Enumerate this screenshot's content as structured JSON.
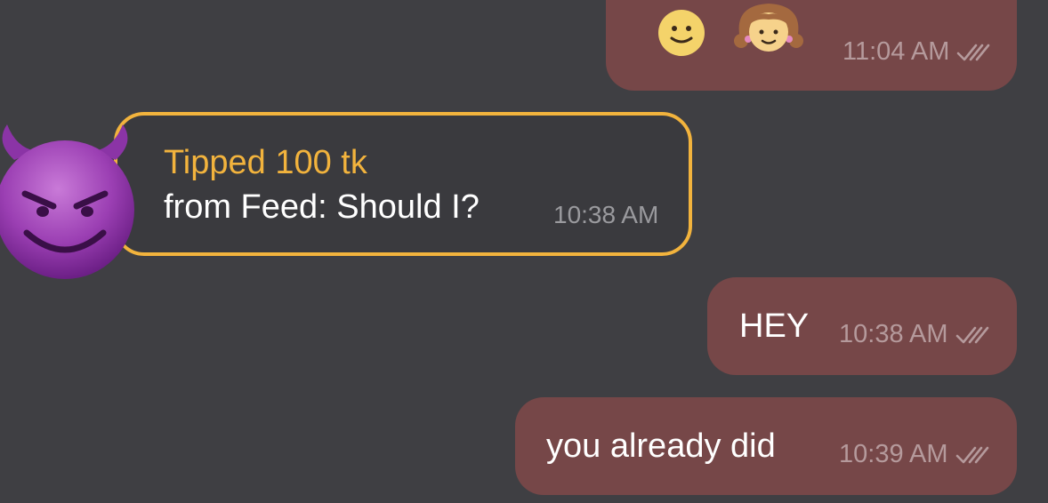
{
  "conversation": {
    "messages": [
      {
        "direction": "outgoing",
        "content": "emoji",
        "emojis": [
          "slightly-smiling-face",
          "girl-face"
        ],
        "time": "11:04 AM",
        "status": "read"
      },
      {
        "direction": "incoming",
        "type": "tip",
        "avatar": "smiling-devil-face",
        "title": "Tipped 100 tk",
        "body": "from Feed: Should I?",
        "time": "10:38 AM"
      },
      {
        "direction": "outgoing",
        "text": "HEY",
        "time": "10:38 AM",
        "status": "read"
      },
      {
        "direction": "outgoing",
        "text": "you already did",
        "time": "10:39 AM",
        "status": "read"
      }
    ]
  },
  "colors": {
    "background": "#3f3f43",
    "outgoing_bubble": "#764748",
    "tip_border": "#f2b33d",
    "tip_title": "#f2b33d",
    "meta_text": "#b59a9c"
  },
  "icons": {
    "read_receipt": "double-check-icon",
    "avatar": "smiling-devil-icon"
  }
}
